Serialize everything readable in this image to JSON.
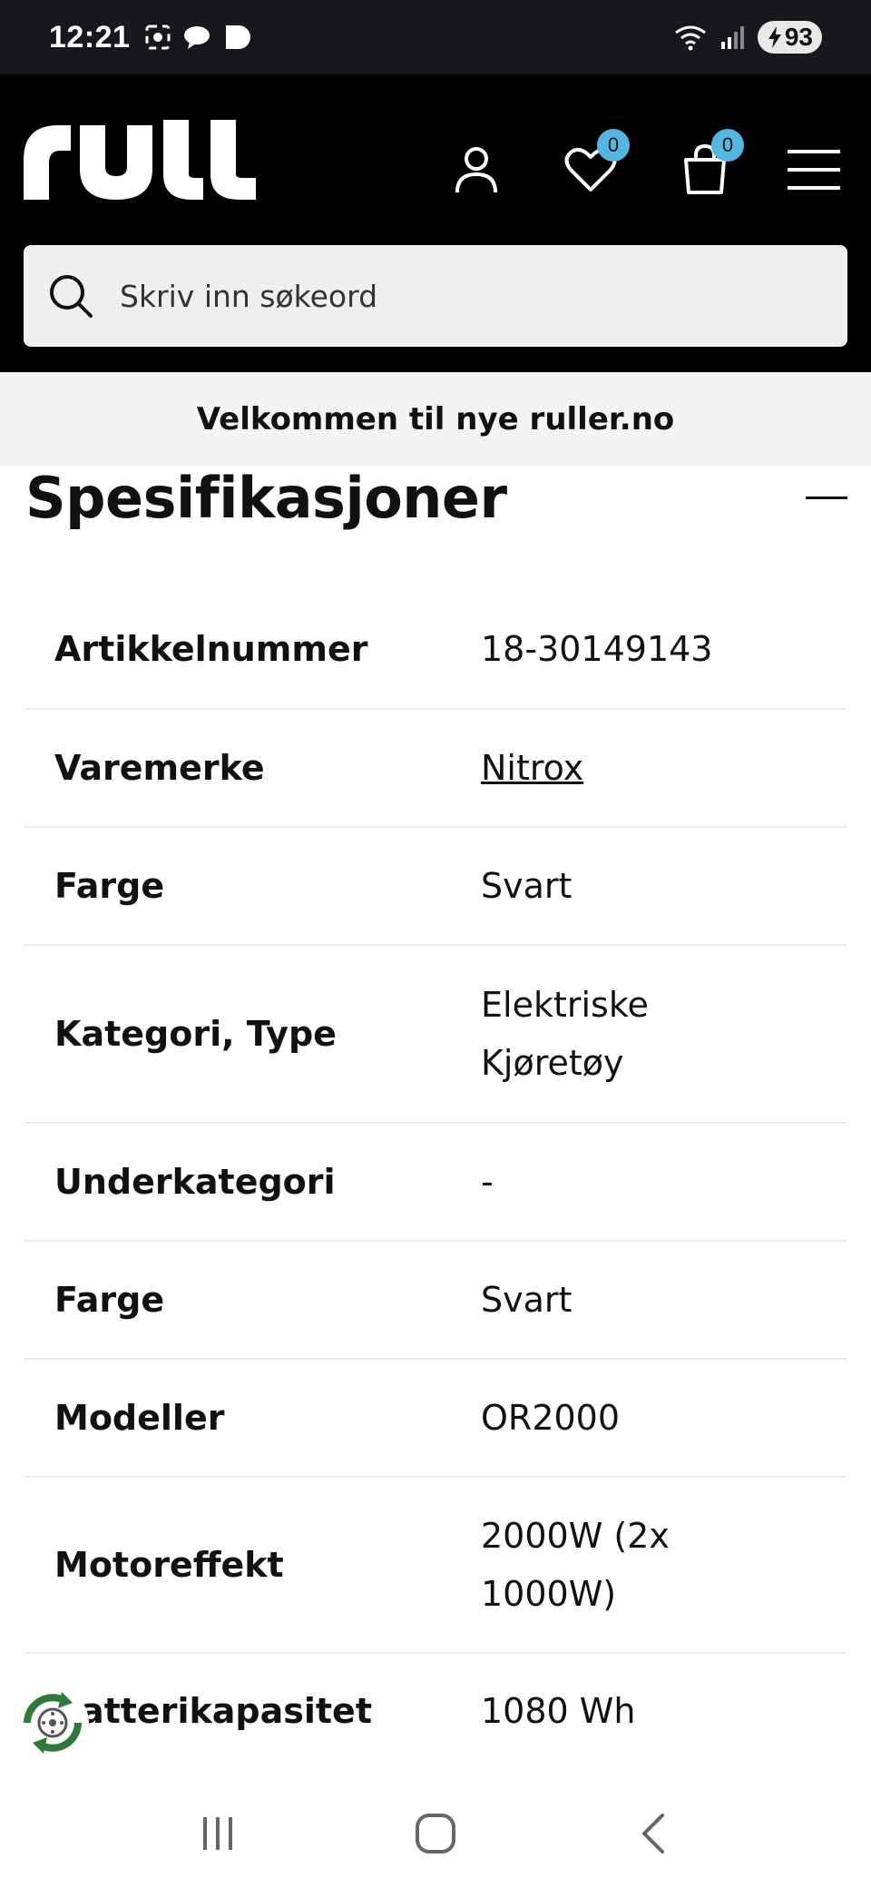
{
  "status_bar": {
    "time": "12:21",
    "battery": "93",
    "icons": [
      "screenshot-icon",
      "chat-bubble-icon",
      "play-icon",
      "wifi-icon",
      "signal-icon",
      "battery-icon"
    ]
  },
  "header": {
    "logo_text": "rull",
    "wishlist_count": "0",
    "cart_count": "0",
    "search_placeholder": "Skriv inn søkeord",
    "badge_color": "#54b7e2"
  },
  "banner": {
    "text": "Velkommen til nye ruller.no"
  },
  "specs": {
    "title": "Spesifikasjoner",
    "rows": [
      {
        "label": "Artikkelnummer",
        "value": "18-30149143"
      },
      {
        "label": "Varemerke",
        "value": "Nitrox"
      },
      {
        "label": "Farge",
        "value": "Svart"
      },
      {
        "label": "Kategori, Type",
        "value": "Elektriske Kjøretøy"
      },
      {
        "label": "Underkategori",
        "value": "-"
      },
      {
        "label": "Farge",
        "value": "Svart"
      },
      {
        "label": "Modeller",
        "value": "OR2000"
      },
      {
        "label": "Motoreffekt",
        "value": "2000W (2x 1000W)"
      },
      {
        "label": "Batterikapasitet",
        "value": "1080 Wh"
      }
    ]
  }
}
